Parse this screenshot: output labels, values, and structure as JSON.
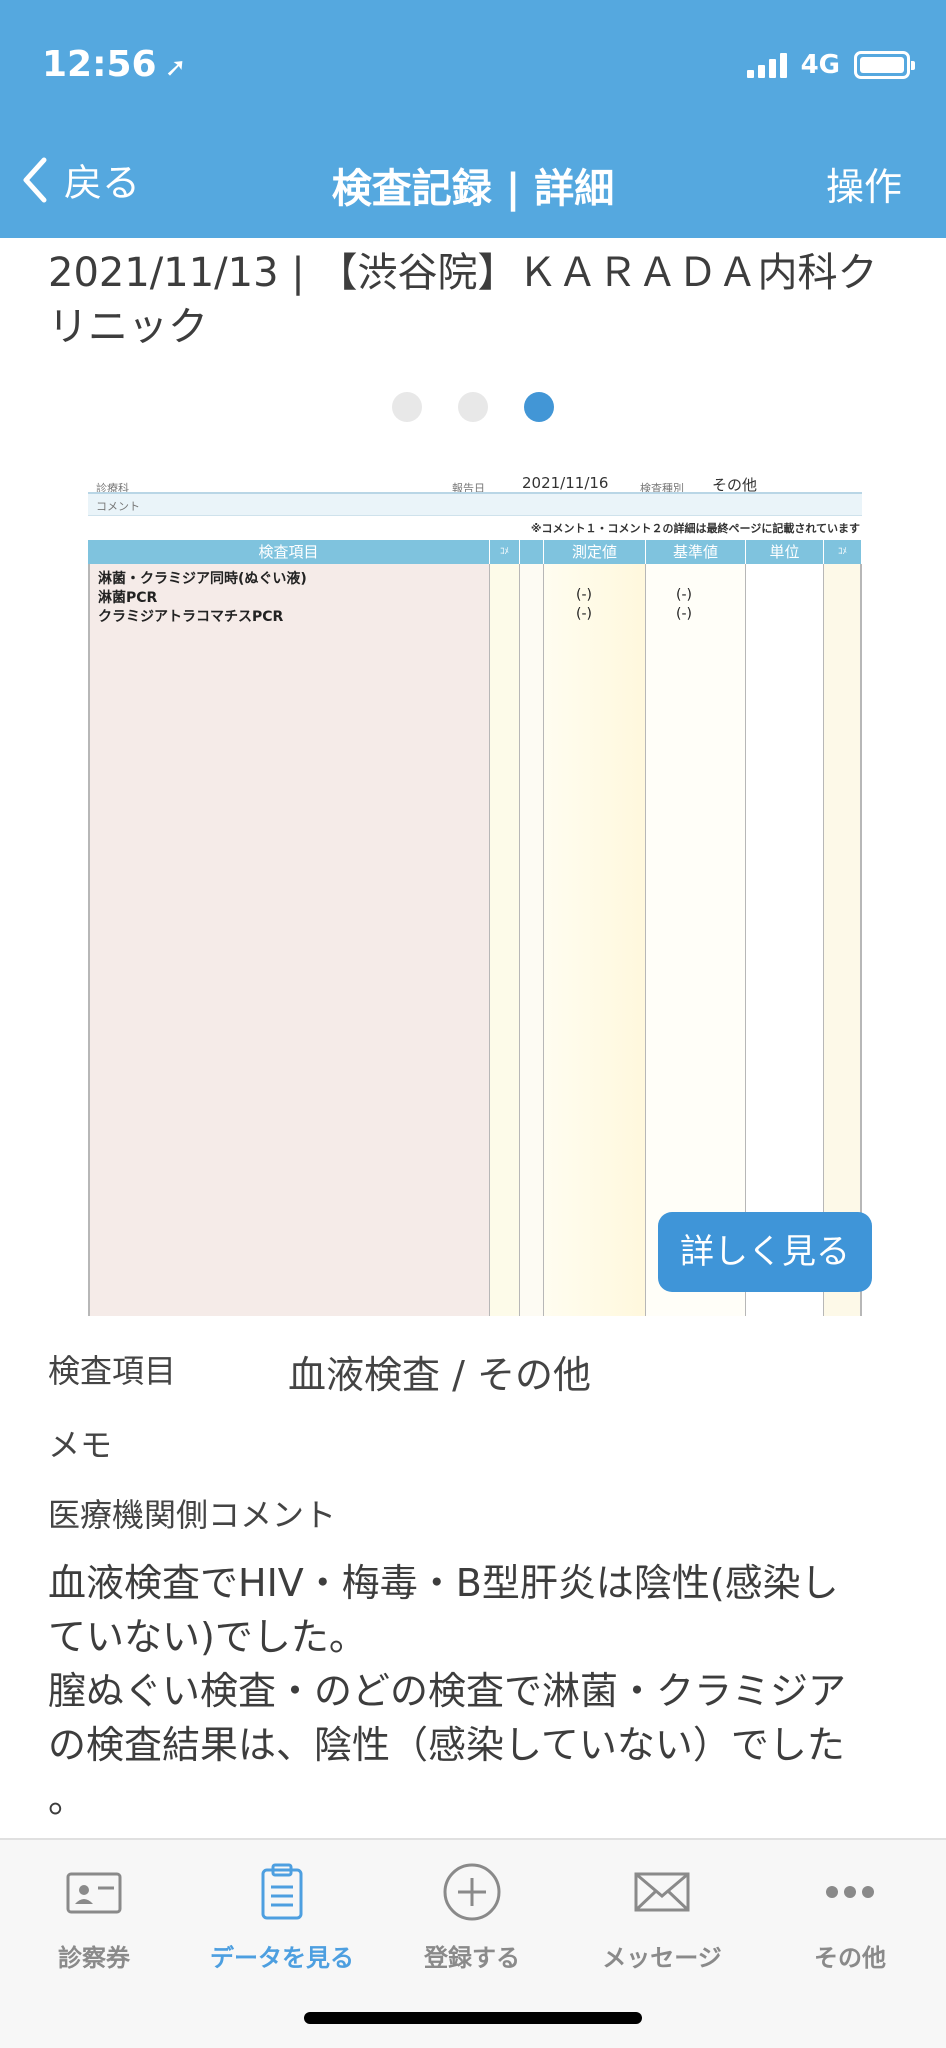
{
  "status": {
    "time": "12:56",
    "network": "4G"
  },
  "nav": {
    "back_label": "戻る",
    "title": "検査記録 | 詳細",
    "action_label": "操作"
  },
  "record": {
    "heading": "2021/11/13 | 【渋谷院】ＫＡＲＡＤＡ内科クリニック"
  },
  "pager": {
    "count": 3,
    "active": 3
  },
  "document": {
    "label_dept": "診療科",
    "label_report_date": "報告日",
    "report_date": "2021/11/16",
    "label_exam_type": "検査種別",
    "exam_type": "その他",
    "comment_label": "コメント",
    "note": "※コメント１・コメント２の詳細は最終ページに記載されています",
    "columns": [
      "検査項目",
      "ｺﾒ",
      "",
      "測定値",
      "基準値",
      "単位",
      "ｺﾒ"
    ],
    "rows": [
      {
        "name": "淋菌・クラミジア同時(ぬぐい液)",
        "value": "",
        "reference": ""
      },
      {
        "name": "淋菌PCR",
        "value": "(-)",
        "reference": "(-)"
      },
      {
        "name": "クラミジアトラコマチスPCR",
        "value": "(-)",
        "reference": "(-)"
      }
    ]
  },
  "detail_button": "詳しく見る",
  "fields": {
    "exam_label": "検査項目",
    "exam_value": "血液検査 / その他",
    "memo_label": "メモ",
    "comment_label": "医療機関側コメント",
    "comment_line1": "血液検査でHIV・梅毒・B型肝炎は陰性(感染し",
    "comment_line2": "ていない)でした。",
    "comment_line3": "膣ぬぐい検査・のどの検査で淋菌・クラミジア",
    "comment_line4": "の検査結果は、陰性（感染していない）でした",
    "comment_line5": "。"
  },
  "tabs": [
    {
      "label": "診察券",
      "icon": "id-card-icon"
    },
    {
      "label": "データを見る",
      "icon": "clipboard-icon",
      "active": true
    },
    {
      "label": "登録する",
      "icon": "plus-circle-icon"
    },
    {
      "label": "メッセージ",
      "icon": "envelope-icon"
    },
    {
      "label": "その他",
      "icon": "more-dots-icon"
    }
  ],
  "colors": {
    "header": "#55a8df",
    "accent": "#4d9fe0",
    "button": "#3f95d8"
  }
}
